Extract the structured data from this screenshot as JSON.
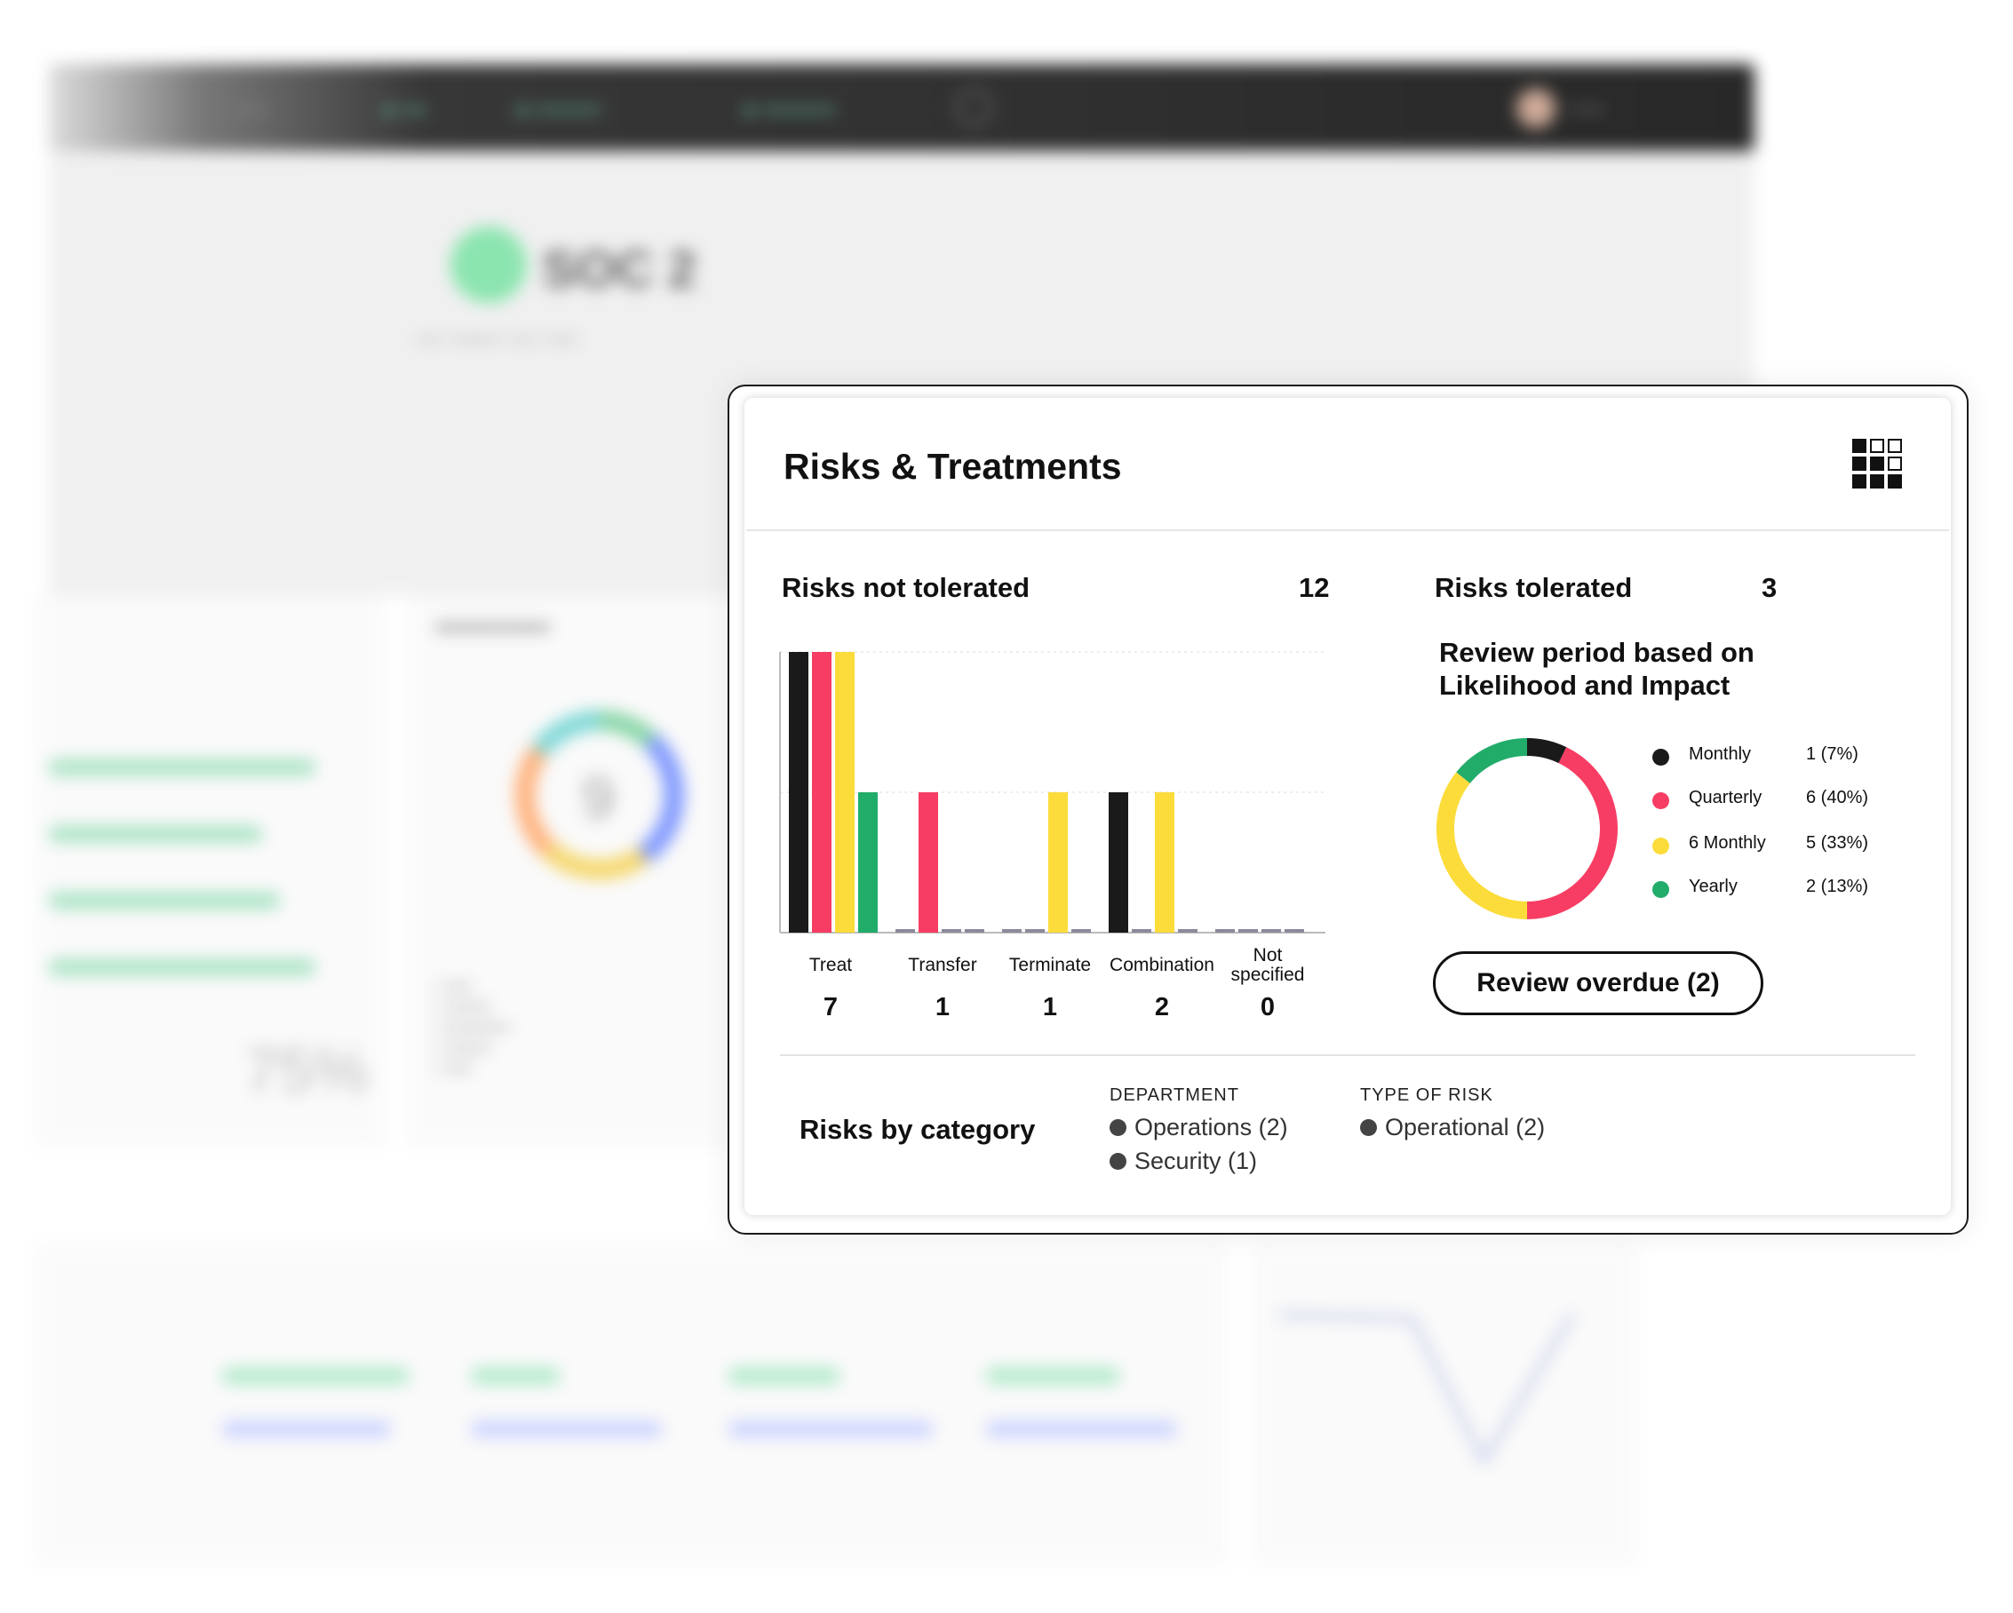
{
  "card": {
    "title": "Risks & Treatments",
    "grid_icon": "grid-layout-icon"
  },
  "not_tolerated": {
    "label": "Risks not tolerated",
    "count": "12"
  },
  "tolerated": {
    "label": "Risks tolerated",
    "count": "3",
    "review_title": "Review period based on Likelihood and Impact"
  },
  "chart_data": [
    {
      "type": "bar",
      "categories": [
        "Treat",
        "Transfer",
        "Terminate",
        "Combination",
        "Not specified"
      ],
      "totals": [
        "7",
        "1",
        "1",
        "2",
        "0"
      ],
      "series": [
        {
          "name": "Monthly",
          "color": "#1a1a1a",
          "values": [
            2,
            0,
            0,
            1,
            0
          ]
        },
        {
          "name": "Quarterly",
          "color": "#f73d63",
          "values": [
            2,
            1,
            0,
            0,
            0
          ]
        },
        {
          "name": "6 Monthly",
          "color": "#fcdc3a",
          "values": [
            2,
            0,
            1,
            1,
            0
          ]
        },
        {
          "name": "Yearly",
          "color": "#22ac6a",
          "values": [
            1,
            0,
            0,
            0,
            0
          ]
        }
      ],
      "ylim": [
        0,
        2
      ],
      "grid": true
    },
    {
      "type": "pie",
      "variant": "donut",
      "categories": [
        "Monthly",
        "Quarterly",
        "6 Monthly",
        "Yearly"
      ],
      "values": [
        1,
        6,
        5,
        2
      ],
      "colors": [
        "#1a1a1a",
        "#f73d63",
        "#fcdc3a",
        "#22ac6a"
      ]
    }
  ],
  "legend": [
    {
      "label": "Monthly",
      "value": "1 (7%)",
      "color": "#1a1a1a"
    },
    {
      "label": "Quarterly",
      "value": "6 (40%)",
      "color": "#f73d63"
    },
    {
      "label": "6 Monthly",
      "value": "5 (33%)",
      "color": "#fcdc3a"
    },
    {
      "label": "Yearly",
      "value": "2 (13%)",
      "color": "#22ac6a"
    }
  ],
  "review_button": "Review overdue (2)",
  "by_category": {
    "title": "Risks by category",
    "department_heading": "DEPARTMENT",
    "department_items": [
      "Operations (2)",
      "Security (1)"
    ],
    "type_heading": "TYPE OF RISK",
    "type_items": [
      "Operational (2)"
    ]
  },
  "background": {
    "page_title": "SOC 2",
    "big_number": "75%",
    "donut_number": "9"
  }
}
